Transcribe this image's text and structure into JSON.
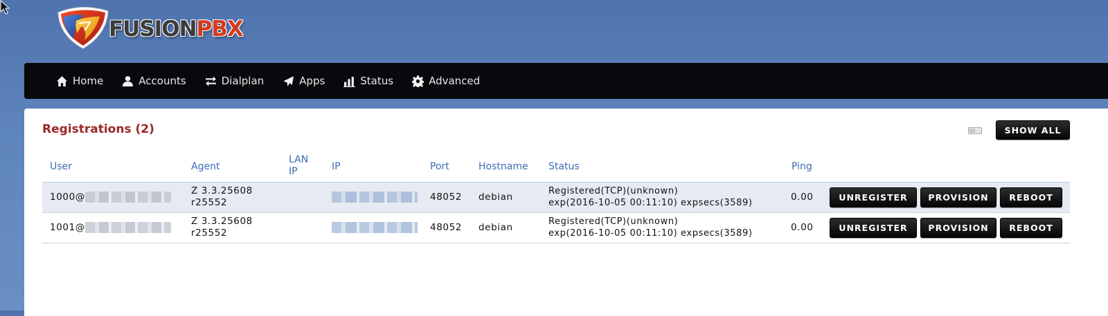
{
  "brand": {
    "name_part1": "FUSION",
    "name_part2": "PBX",
    "accent": "#d23a1c"
  },
  "nav": [
    {
      "icon": "home-icon",
      "label": "Home"
    },
    {
      "icon": "user-icon",
      "label": "Accounts"
    },
    {
      "icon": "transfer-icon",
      "label": "Dialplan"
    },
    {
      "icon": "send-icon",
      "label": "Apps"
    },
    {
      "icon": "bar-chart-icon",
      "label": "Status"
    },
    {
      "icon": "gear-icon",
      "label": "Advanced"
    }
  ],
  "page": {
    "title": "Registrations (2)",
    "show_all_label": "SHOW ALL"
  },
  "table": {
    "headers": {
      "user": "User",
      "agent": "Agent",
      "lan_ip_1": "LAN",
      "lan_ip_2": "IP",
      "ip": "IP",
      "port": "Port",
      "hostname": "Hostname",
      "status": "Status",
      "ping": "Ping"
    },
    "rows": [
      {
        "user": "1000@",
        "agent_1": "Z 3.3.25608",
        "agent_2": "r25552",
        "lan_ip": "",
        "port": "48052",
        "hostname": "debian",
        "status_1": "Registered(TCP)(unknown)",
        "status_2": "exp(2016-10-05 00:11:10) expsecs(3589)",
        "ping": "0.00",
        "actions": {
          "unregister": "UNREGISTER",
          "provision": "PROVISION",
          "reboot": "REBOOT"
        }
      },
      {
        "user": "1001@",
        "agent_1": "Z 3.3.25608",
        "agent_2": "r25552",
        "lan_ip": "",
        "port": "48052",
        "hostname": "debian",
        "status_1": "Registered(TCP)(unknown)",
        "status_2": "exp(2016-10-05 00:11:10) expsecs(3589)",
        "ping": "0.00",
        "actions": {
          "unregister": "UNREGISTER",
          "provision": "PROVISION",
          "reboot": "REBOOT"
        }
      }
    ]
  }
}
